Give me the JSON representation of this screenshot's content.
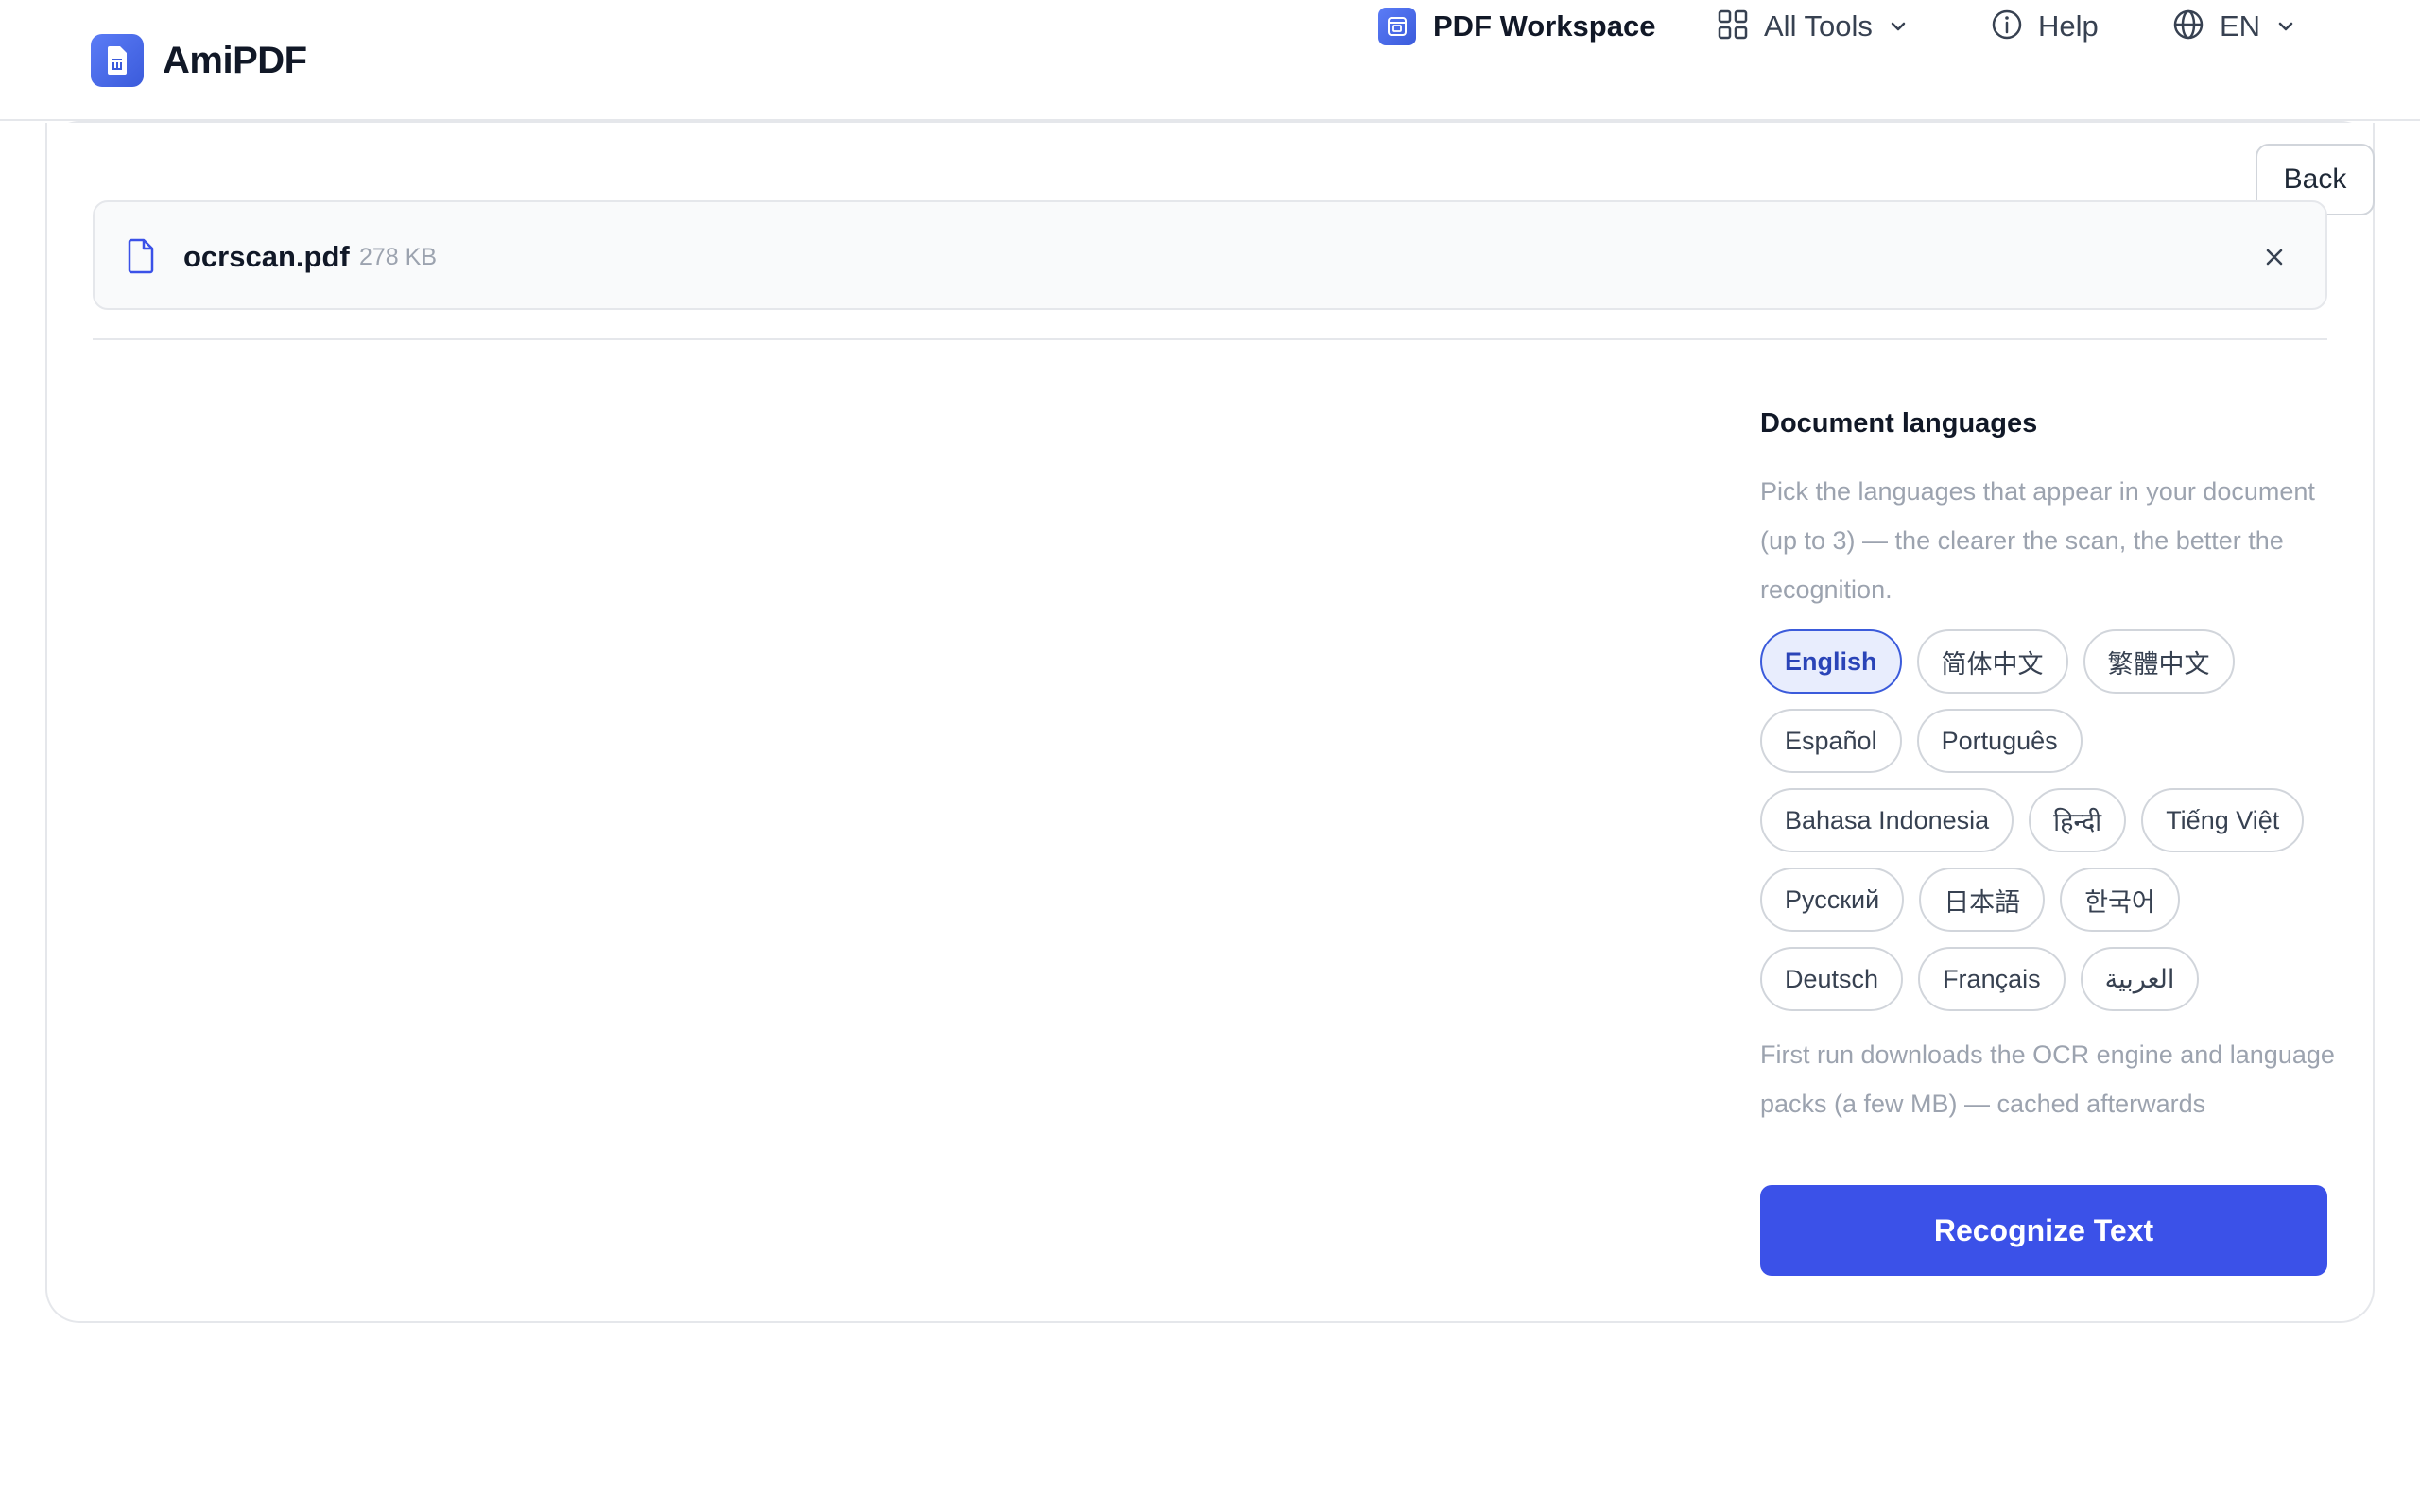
{
  "brand": {
    "name": "AmiPDF",
    "logo_icon": "pdf-app-icon"
  },
  "nav": {
    "workspace": "PDF Workspace",
    "all_tools": "All Tools",
    "help": "Help",
    "language": "EN"
  },
  "back_label": "Back",
  "file": {
    "name": "ocrscan.pdf",
    "size": "278 KB"
  },
  "panel": {
    "title": "Document languages",
    "description": "Pick the languages that appear in your document (up to 3) — the clearer the scan, the better the recognition.",
    "languages": [
      [
        "English",
        "简体中文",
        "繁體中文"
      ],
      [
        "Español",
        "Português"
      ],
      [
        "Bahasa Indonesia",
        "हिन्दी",
        "Tiếng Việt"
      ],
      [
        "Русский",
        "日本語",
        "한국어"
      ],
      [
        "Deutsch",
        "Français",
        "العربية"
      ]
    ],
    "selected": [
      "English"
    ],
    "note": "First run downloads the OCR engine and language packs (a few MB) — cached afterwards",
    "action": "Recognize Text"
  },
  "colors": {
    "accent": "#3b51e8",
    "selected_bg": "#e8edfd",
    "muted_text": "#9ca3af"
  }
}
